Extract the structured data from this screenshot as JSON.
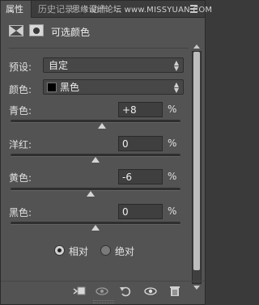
{
  "tabs": [
    {
      "label": "属性",
      "active": true
    },
    {
      "label": "历史记录",
      "active": false
    },
    {
      "label": "动作",
      "active": false
    }
  ],
  "watermark": "思缘设计论坛 www.MISSYUAN.COM",
  "header": {
    "title": "可选颜色",
    "adjustment_icon": "selective-color-icon",
    "mask_icon": "layer-mask-icon"
  },
  "preset": {
    "label": "预设:",
    "value": "自定"
  },
  "colors": {
    "label": "颜色:",
    "value": "黑色",
    "swatch": "#000000"
  },
  "sliders": [
    {
      "label": "青色:",
      "value": "+8",
      "unit": "%",
      "level": 8
    },
    {
      "label": "洋红:",
      "value": "0",
      "unit": "%",
      "level": 0
    },
    {
      "label": "黄色:",
      "value": "-6",
      "unit": "%",
      "level": -6
    },
    {
      "label": "黑色:",
      "value": "0",
      "unit": "%",
      "level": 0
    }
  ],
  "method": {
    "options": [
      {
        "label": "相对",
        "selected": true
      },
      {
        "label": "绝对",
        "selected": false
      }
    ]
  },
  "toolbar": {
    "icons": [
      "clip-to-layer-icon",
      "view-previous-icon",
      "reset-icon",
      "visibility-eye-icon",
      "trash-icon"
    ]
  },
  "colors_theme": {
    "panel": "#535353",
    "tab_bar": "#3c3c3c",
    "field": "#3f3f3f",
    "thumb": "#d4d4d4"
  }
}
